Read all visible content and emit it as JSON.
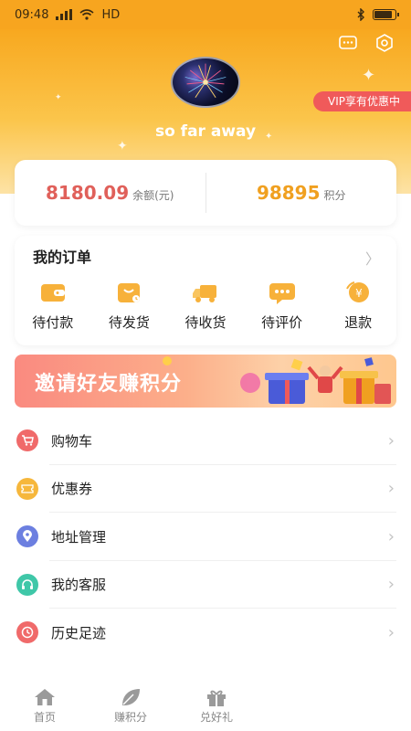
{
  "status_bar": {
    "time": "09:48",
    "network": "HD"
  },
  "profile": {
    "username": "so far away",
    "vip_badge": "VIP享有优惠中"
  },
  "balance": {
    "amount": "8180.09",
    "amount_label": "余额(元)",
    "amount_color": "#e0605a",
    "points": "98895",
    "points_label": "积分",
    "points_color": "#f0a020"
  },
  "orders": {
    "title": "我的订单",
    "items": [
      {
        "label": "待付款",
        "icon": "wallet-icon"
      },
      {
        "label": "待发货",
        "icon": "package-icon"
      },
      {
        "label": "待收货",
        "icon": "truck-icon"
      },
      {
        "label": "待评价",
        "icon": "comment-icon"
      },
      {
        "label": "退款",
        "icon": "refund-icon"
      }
    ]
  },
  "banner": {
    "text": "邀请好友赚积分"
  },
  "menu": [
    {
      "label": "购物车",
      "icon": "cart-icon",
      "color": "#f06a6a"
    },
    {
      "label": "优惠券",
      "icon": "coupon-icon",
      "color": "#f6b73c"
    },
    {
      "label": "地址管理",
      "icon": "location-icon",
      "color": "#6c7fe0"
    },
    {
      "label": "我的客服",
      "icon": "headset-icon",
      "color": "#3fc7a8"
    },
    {
      "label": "历史足迹",
      "icon": "clock-icon",
      "color": "#f06a6a"
    }
  ],
  "tabbar": [
    {
      "label": "首页",
      "icon": "home-icon"
    },
    {
      "label": "赚积分",
      "icon": "leaf-icon"
    },
    {
      "label": "兑好礼",
      "icon": "gift-icon"
    }
  ],
  "colors": {
    "accent": "#f8a81f",
    "icon_orange": "#f7b13a",
    "tab_gray": "#9a9a9a"
  }
}
